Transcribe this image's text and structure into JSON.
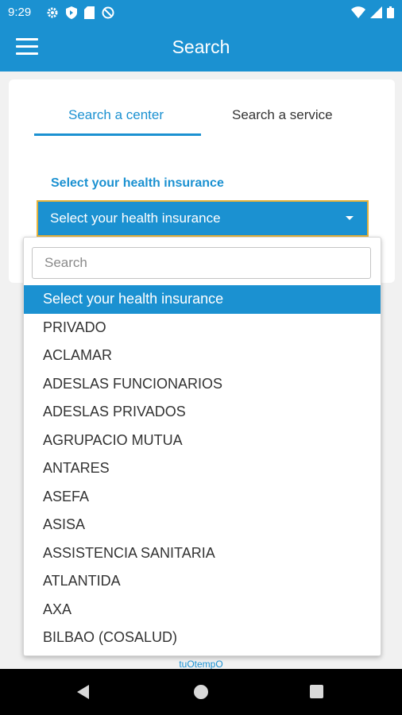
{
  "status_bar": {
    "time": "9:29",
    "left_icons": [
      "gear-icon",
      "shield-icon",
      "sd-card-icon",
      "at-sign-icon"
    ],
    "right_icons": [
      "wifi-icon",
      "cell-signal-icon",
      "battery-icon"
    ]
  },
  "app_bar": {
    "title": "Search",
    "menu_icon": "hamburger-menu-icon"
  },
  "tabs": [
    {
      "label": "Search a center",
      "active": true
    },
    {
      "label": "Search a service",
      "active": false
    }
  ],
  "form": {
    "label": "Select your health insurance",
    "selected_value": "Select your health insurance"
  },
  "dropdown": {
    "search_placeholder": "Search",
    "options": [
      "Select your health insurance",
      "PRIVADO",
      "ACLAMAR",
      "ADESLAS FUNCIONARIOS",
      "ADESLAS PRIVADOS",
      "AGRUPACIO MUTUA",
      "ANTARES",
      "ASEFA",
      "ASISA",
      "ASSISTENCIA SANITARIA",
      "ATLANTIDA",
      "AXA",
      "BILBAO (COSALUD)"
    ],
    "selected_index": 0
  },
  "footer": {
    "link": "tuOtempO"
  },
  "nav_bar": {
    "buttons": [
      "back-icon",
      "home-icon",
      "recents-icon"
    ]
  },
  "colors": {
    "primary": "#1b91d1",
    "focus_border": "#e3b23c",
    "background": "#f1f1f1"
  }
}
